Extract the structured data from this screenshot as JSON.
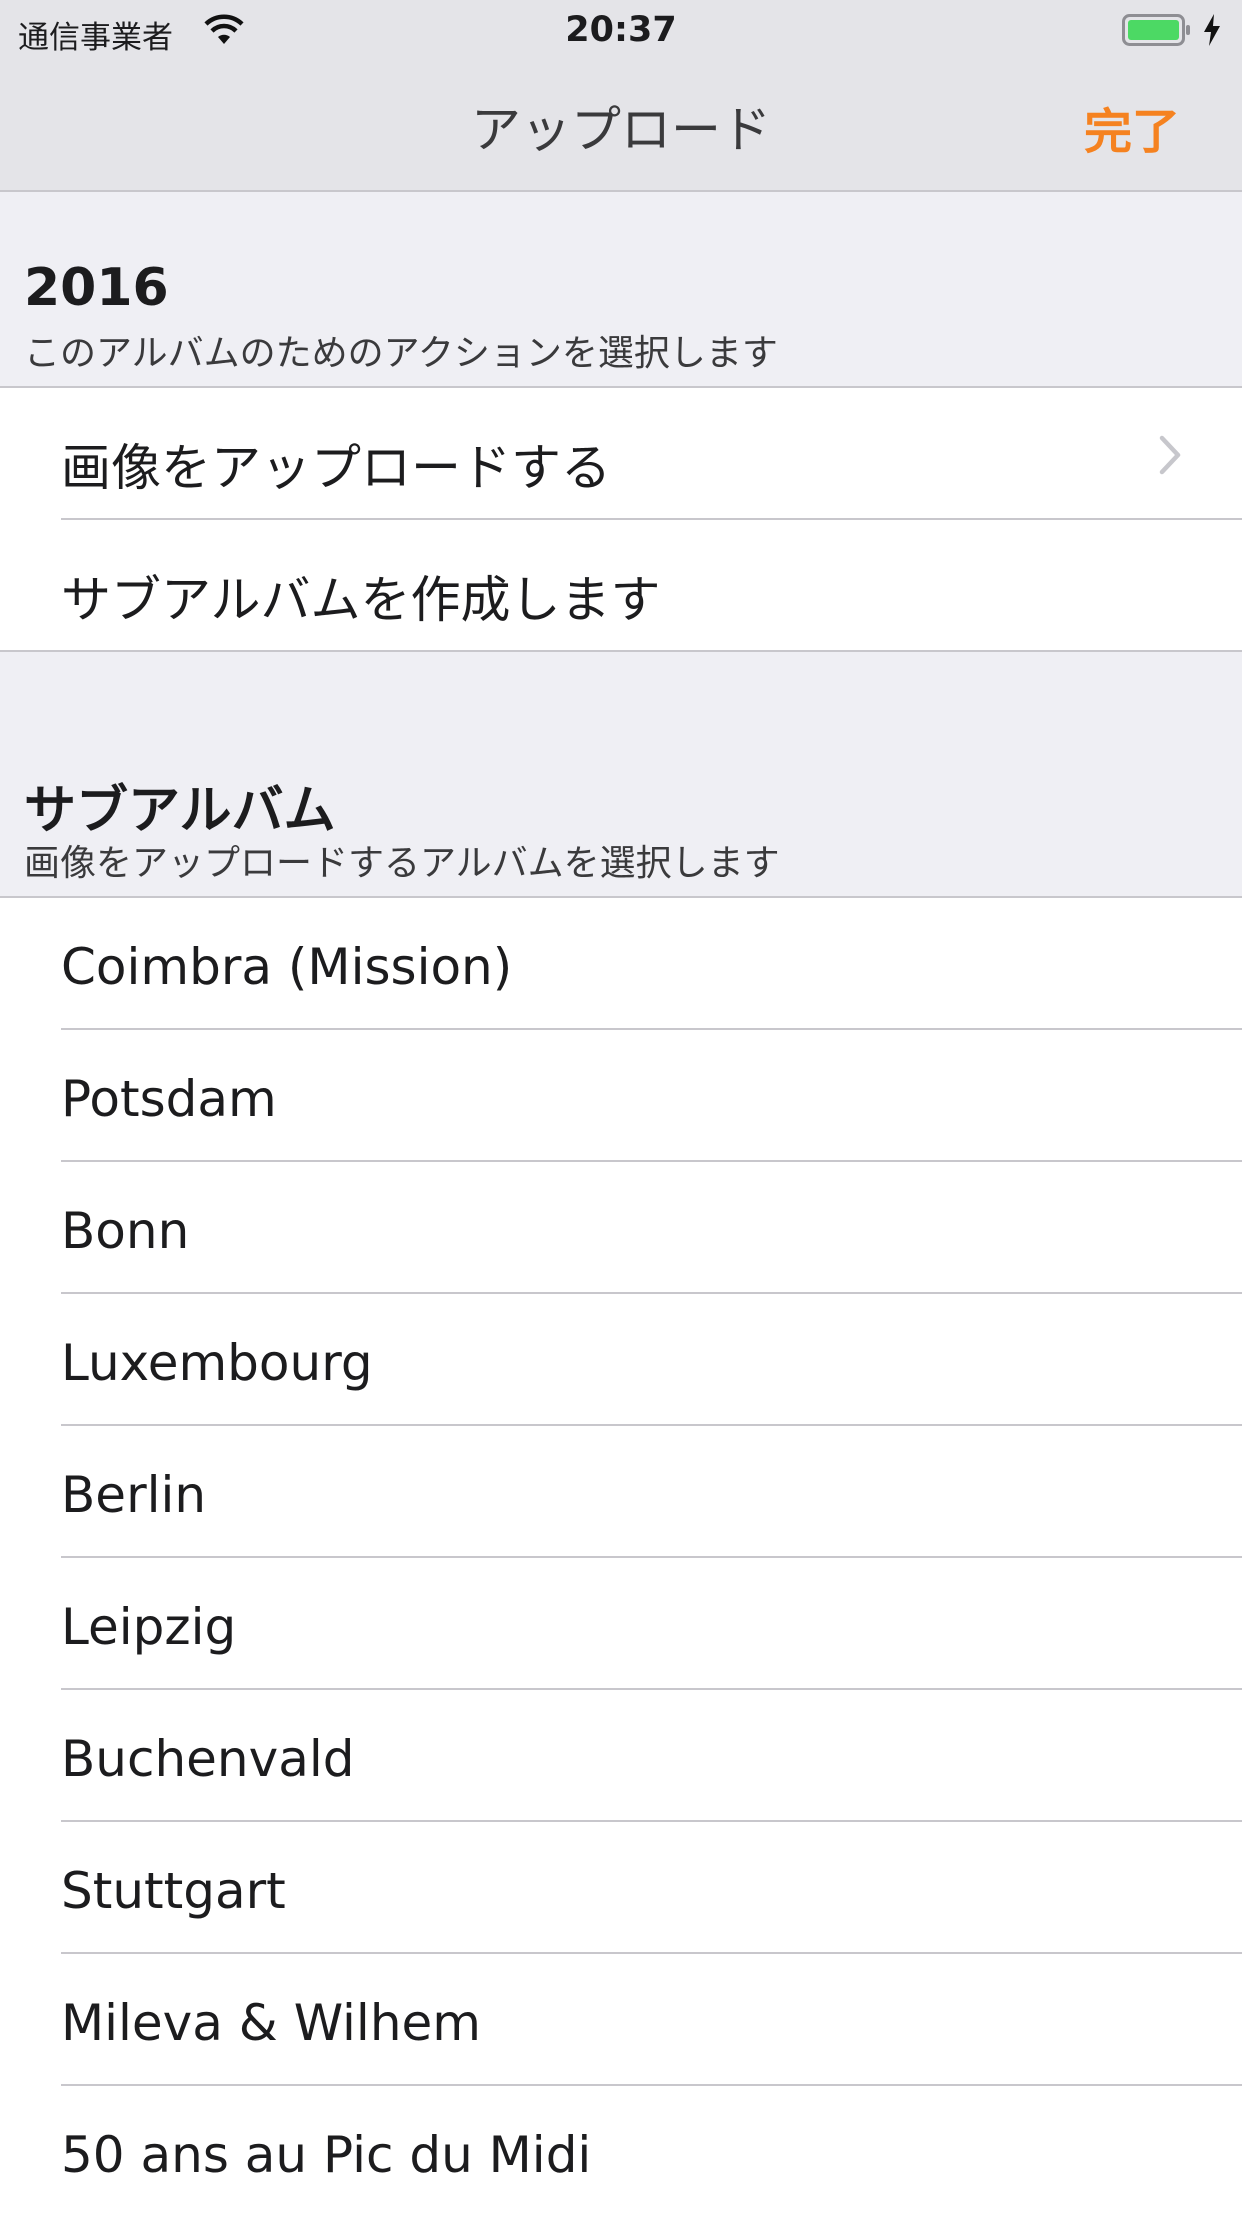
{
  "status_bar": {
    "carrier": "通信事業者",
    "time": "20:37"
  },
  "nav": {
    "title": "アップロード",
    "done_label": "完了",
    "accent_color": "#f58220"
  },
  "sections": {
    "actions": {
      "title": "2016",
      "subtitle": "このアルバムのためのアクションを選択します",
      "items": [
        {
          "label": "画像をアップロードする",
          "icon": "chevron-right-icon"
        },
        {
          "label": "サブアルバムを作成します"
        }
      ]
    },
    "subalbums": {
      "title": "サブアルバム",
      "subtitle": "画像をアップロードするアルバムを選択します",
      "items": [
        {
          "label": "Coimbra (Mission)"
        },
        {
          "label": "Potsdam"
        },
        {
          "label": "Bonn"
        },
        {
          "label": "Luxembourg"
        },
        {
          "label": "Berlin"
        },
        {
          "label": "Leipzig"
        },
        {
          "label": "Buchenvald"
        },
        {
          "label": "Stuttgart"
        },
        {
          "label": "Mileva & Wilhem"
        },
        {
          "label": "50 ans au Pic du Midi"
        }
      ]
    }
  }
}
